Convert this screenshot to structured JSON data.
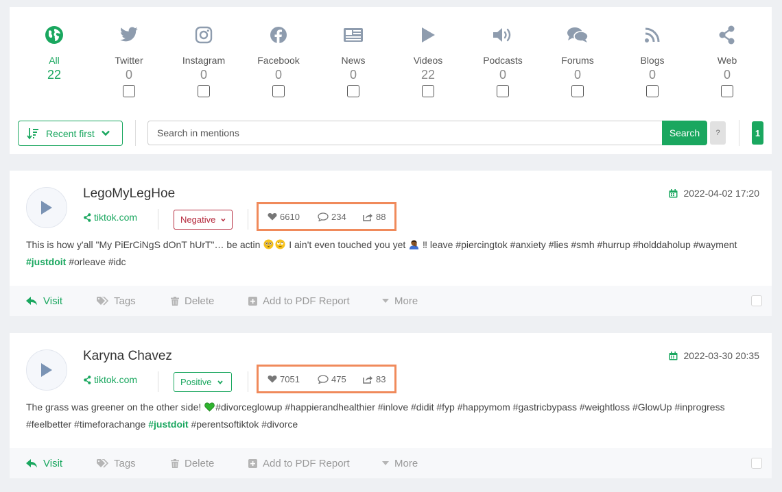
{
  "sources": [
    {
      "label": "All",
      "count": "22",
      "icon": "globe-icon",
      "active": true
    },
    {
      "label": "Twitter",
      "count": "0",
      "icon": "twitter-icon"
    },
    {
      "label": "Instagram",
      "count": "0",
      "icon": "instagram-icon"
    },
    {
      "label": "Facebook",
      "count": "0",
      "icon": "facebook-icon"
    },
    {
      "label": "News",
      "count": "0",
      "icon": "newspaper-icon"
    },
    {
      "label": "Videos",
      "count": "22",
      "icon": "play-icon"
    },
    {
      "label": "Podcasts",
      "count": "0",
      "icon": "speaker-icon"
    },
    {
      "label": "Forums",
      "count": "0",
      "icon": "chat-bubbles-icon"
    },
    {
      "label": "Blogs",
      "count": "0",
      "icon": "rss-icon"
    },
    {
      "label": "Web",
      "count": "0",
      "icon": "share-icon"
    }
  ],
  "toolbar": {
    "sort_label": "Recent first",
    "search_placeholder": "Search in mentions",
    "search_button": "Search",
    "help_label": "?",
    "page": "1"
  },
  "actions": {
    "visit": "Visit",
    "tags": "Tags",
    "delete": "Delete",
    "pdf": "Add to PDF Report",
    "more": "More"
  },
  "mentions": [
    {
      "author": "LegoMyLegHoe",
      "domain": "tiktok.com",
      "sentiment": "Negative",
      "likes": "6610",
      "comments": "234",
      "shares": "88",
      "date": "2022-04-02 17:20",
      "text_a": "This is how y'all \"My PiErCiNgS dOnT hUrT\"… be actin",
      "text_b": " I ain't even touched you yet ",
      "text_c": "‼ leave #piercingtok #anxiety #lies #smh #hurrup #holddaholup #wayment ",
      "hashtag": "#justdoit",
      "text_d": " #orleave #idc"
    },
    {
      "author": "Karyna Chavez",
      "domain": "tiktok.com",
      "sentiment": "Positive",
      "likes": "7051",
      "comments": "475",
      "shares": "83",
      "date": "2022-03-30 20:35",
      "text_a": "The grass was greener on the other side! ",
      "text_b": "#divorceglowup #happierandhealthier #inlove #didit #fyp #happymom #gastricbypass #weightloss #GlowUp #inprogress #feelbetter #timeforachange ",
      "hashtag": "#justdoit",
      "text_c": " #perentsoftiktok #divorce"
    }
  ],
  "colors": {
    "accent": "#1aa75f",
    "negative": "#b52a3d",
    "highlight_box": "#f08a5b",
    "inactive_icon": "#8e9cae"
  }
}
